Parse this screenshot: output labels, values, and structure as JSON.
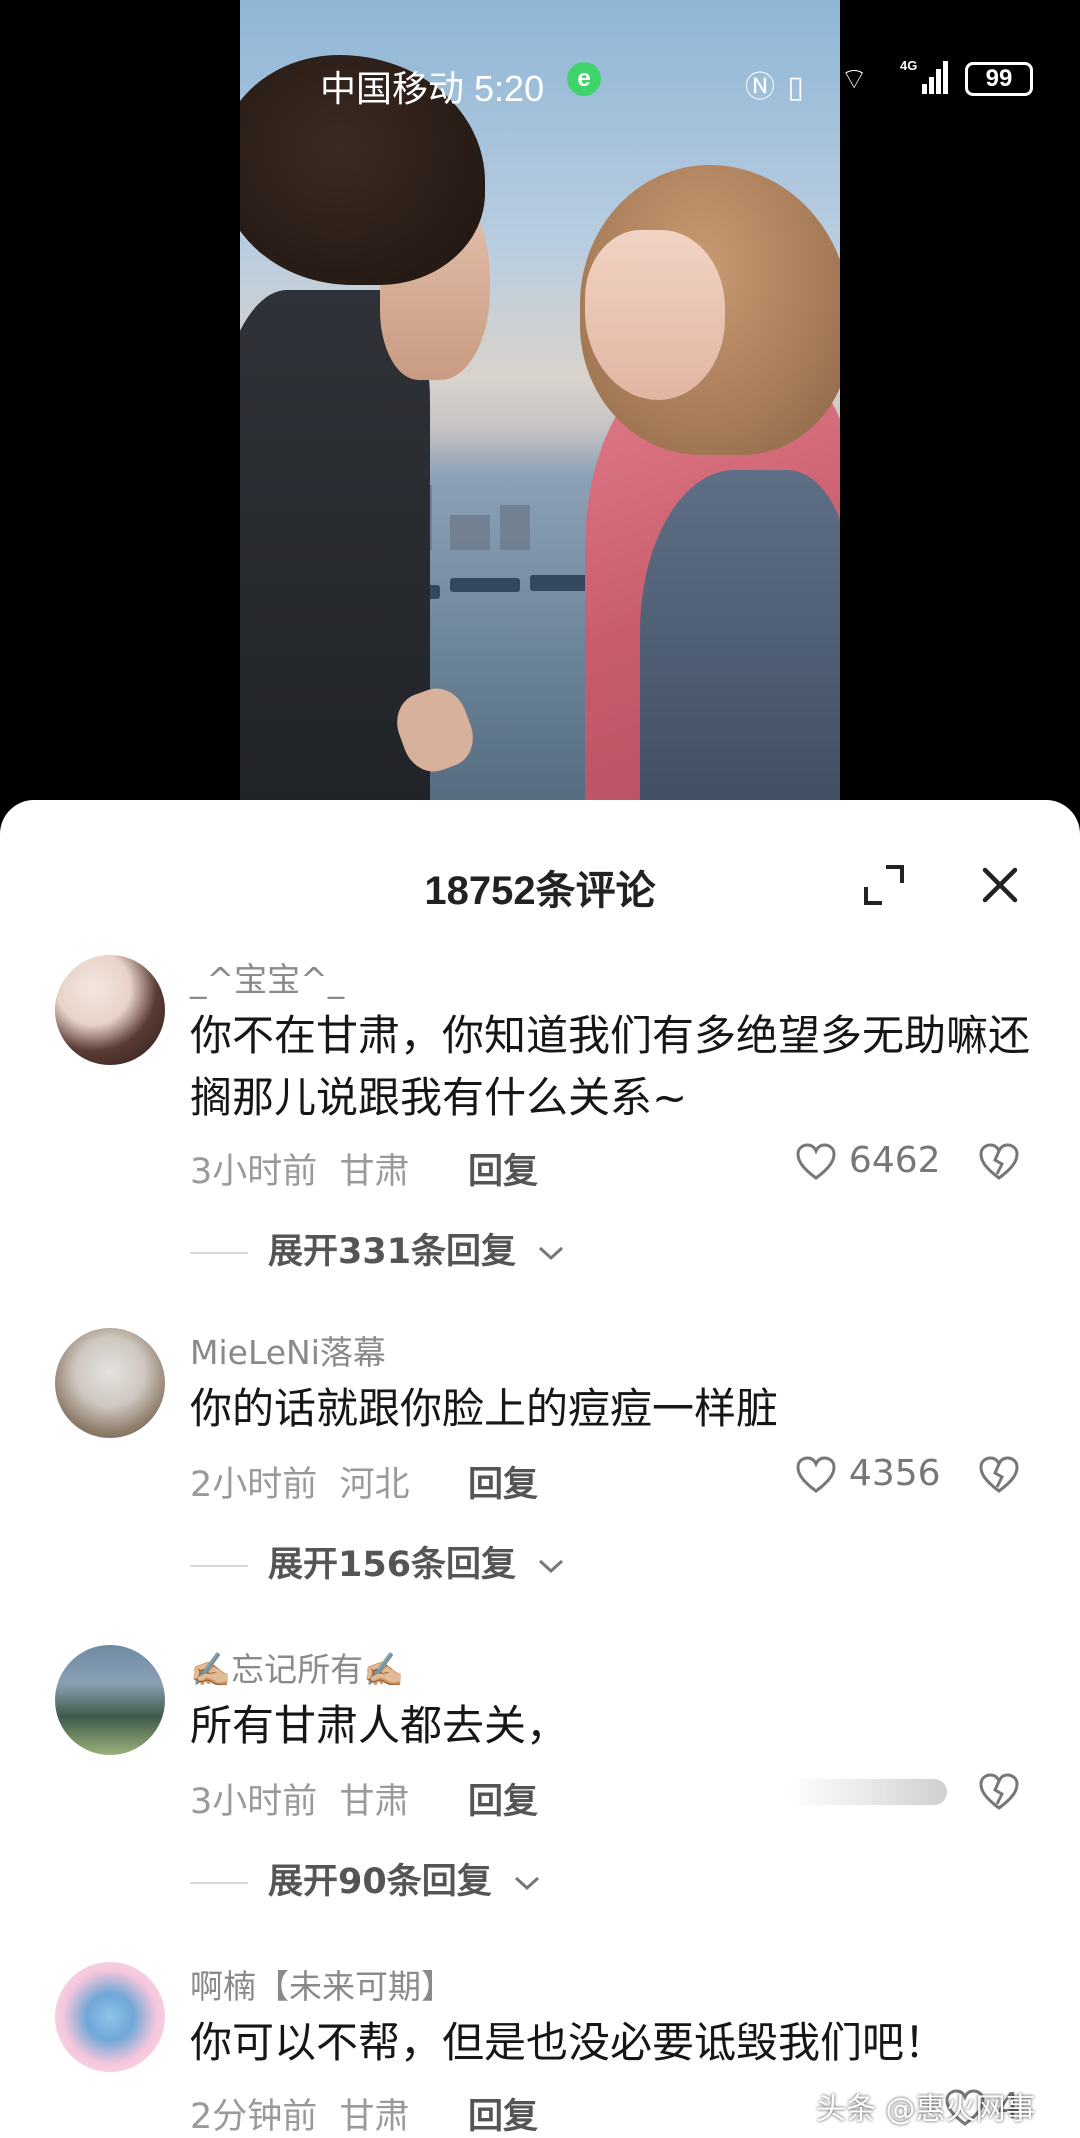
{
  "status_bar": {
    "carrier": "中国移动",
    "time": "5:20",
    "browser_badge": "e",
    "battery": "99",
    "network": "4G"
  },
  "panel": {
    "title": "18752条评论"
  },
  "comments": [
    {
      "author": "_^宝宝^_",
      "text": "你不在甘肃，你知道我们有多绝望多无助嘛还搁那儿说跟我有什么关系~",
      "time": "3小时前",
      "location": "甘肃",
      "reply_label": "回复",
      "likes": "6462",
      "expand_label": "展开331条回复"
    },
    {
      "author": "MieLeNi落幕",
      "text": "你的话就跟你脸上的痘痘一样脏",
      "time": "2小时前",
      "location": "河北",
      "reply_label": "回复",
      "likes": "4356",
      "expand_label": "展开156条回复"
    },
    {
      "author": "✍🏼忘记所有✍🏼",
      "text": "所有甘肃人都去关，",
      "time": "3小时前",
      "location": "甘肃",
      "reply_label": "回复",
      "expand_label": "展开90条回复"
    },
    {
      "author": "啊楠【未来可期】",
      "text": "你可以不帮，但是也没必要诋毁我们吧！",
      "time": "2分钟前",
      "location": "甘肃",
      "reply_label": "回复",
      "likes": "4"
    }
  ],
  "watermark": "头条 @惠火网事",
  "icons": {
    "expand": "fullscreen-expand-icon",
    "close": "close-icon",
    "like": "heart-outline-icon",
    "dislike": "broken-heart-icon",
    "chevron": "chevron-down-icon"
  }
}
